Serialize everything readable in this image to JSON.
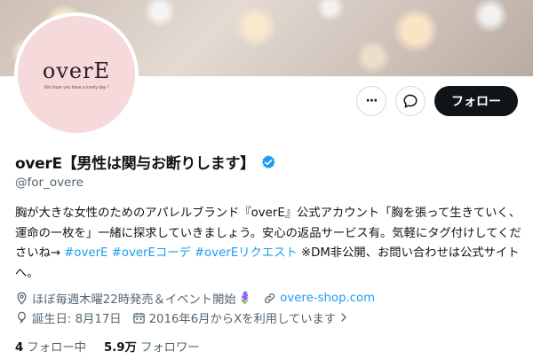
{
  "profile": {
    "avatar_logo": "overE",
    "avatar_tagline": "We hope you have a lovely day !",
    "display_name": "overE【男性は関与お断りします】",
    "handle": "@for_overe",
    "verified": true
  },
  "actions": {
    "more_label": "···",
    "follow_label": "フォロー"
  },
  "bio": {
    "text_1": "胸が大きな女性のためのアパレルブランド『overE』公式アカウント「胸を張って生きていく、運命の一枚を」一緒に探求していきましょう。安心の返品サービス有。気軽にタグ付けしてくださいね→ ",
    "hashtags": [
      "#overE",
      "#overEコーデ",
      "#overEリクエスト"
    ],
    "text_2": " ※DM非公開、お問い合わせは公式サイトへ。"
  },
  "meta": {
    "location": "ほぼ毎週木曜22時発売＆イベント開始",
    "location_emoji": "🪻",
    "website": "overe-shop.com",
    "birthday": "誕生日: 8月17日",
    "joined": "2016年6月からXを利用しています"
  },
  "stats": {
    "following_count": "4",
    "following_label": "フォロー中",
    "followers_count": "5.9万",
    "followers_label": "フォロワー"
  },
  "colors": {
    "accent": "#1d9bf0",
    "text": "#0f1419",
    "muted": "#536471",
    "follow_bg": "#0f1419",
    "avatar_bg": "#f6d9db"
  }
}
